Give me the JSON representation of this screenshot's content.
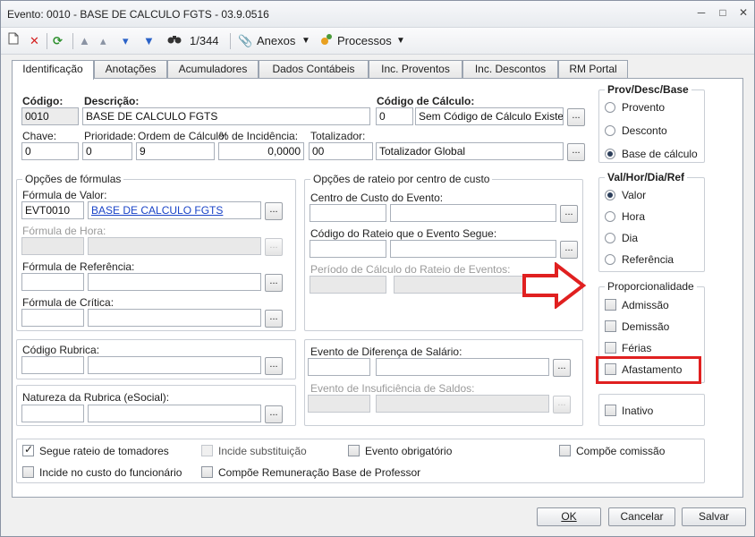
{
  "window": {
    "title": "Evento: 0010 - BASE DE CALCULO FGTS - 03.9.0516"
  },
  "toolbar": {
    "record_counter": "1/344",
    "attachments": "Anexos",
    "processes": "Processos"
  },
  "tabs": [
    "Identificação",
    "Anotações",
    "Acumuladores",
    "Dados Contábeis",
    "Inc. Proventos",
    "Inc. Descontos",
    "RM Portal"
  ],
  "main": {
    "codigo_label": "Código:",
    "codigo": "0010",
    "descricao_label": "Descrição:",
    "descricao": "BASE DE CALCULO FGTS",
    "codigo_calculo_label": "Código de Cálculo:",
    "codigo_calculo": "0",
    "codigo_calculo_desc": "Sem Código de Cálculo Existente",
    "chave_label": "Chave:",
    "chave": "0",
    "prioridade_label": "Prioridade:",
    "prioridade": "0",
    "ordem_label": "Ordem de Cálculo:",
    "ordem": "9",
    "incidencia_label": "% de Incidência:",
    "incidencia": "0,0000",
    "totalizador_label": "Totalizador:",
    "totalizador": "00",
    "totalizador_desc": "Totalizador Global"
  },
  "formulas": {
    "title": "Opções de fórmulas",
    "valor_label": "Fórmula de Valor:",
    "valor_code": "EVT0010",
    "valor_desc": "BASE DE CALCULO FGTS",
    "hora_label": "Fórmula de Hora:",
    "referencia_label": "Fórmula de Referência:",
    "critica_label": "Fórmula de Crítica:"
  },
  "rateio": {
    "title": "Opções de rateio por centro de custo",
    "centro_label": "Centro de Custo do Evento:",
    "codigo_label": "Código do Rateio que o Evento Segue:",
    "periodo_label": "Período de Cálculo do Rateio de Eventos:"
  },
  "rubrica": {
    "codigo_label": "Código Rubrica:",
    "natureza_label": "Natureza da Rubrica (eSocial):"
  },
  "diferenca": {
    "dif_label": "Evento de Diferença de Salário:",
    "insuf_label": "Evento de Insuficiência de Saldos:"
  },
  "prov": {
    "title": "Prov/Desc/Base",
    "options": [
      "Provento",
      "Desconto",
      "Base de cálculo"
    ],
    "selected": "Base de cálculo"
  },
  "valhor": {
    "title": "Val/Hor/Dia/Ref",
    "options": [
      "Valor",
      "Hora",
      "Dia",
      "Referência"
    ],
    "selected": "Valor"
  },
  "proporc": {
    "title": "Proporcionalidade",
    "options": [
      "Admissão",
      "Demissão",
      "Férias",
      "Afastamento"
    ]
  },
  "inativo": "Inativo",
  "flags": {
    "segue_rateio": "Segue rateio de tomadores",
    "incide_subst": "Incide substituição",
    "evento_obrig": "Evento obrigatório",
    "compoe_comissao": "Compõe comissão",
    "incide_custo": "Incide no custo do funcionário",
    "compoe_remun": "Compõe Remuneração Base de Professor"
  },
  "buttons": {
    "ok": "OK",
    "cancel": "Cancelar",
    "save": "Salvar"
  },
  "colors": {
    "annotation": "#e02020",
    "link": "#1a44c8"
  }
}
